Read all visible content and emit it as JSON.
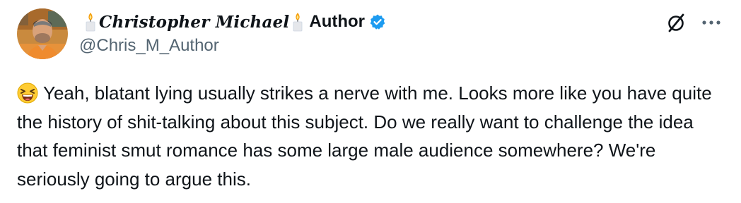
{
  "author": {
    "display_name": "Christopher Michael",
    "name_suffix": "Author",
    "handle": "@Chris_M_Author",
    "verified": true,
    "verified_color": "#1d9bf0"
  },
  "actions": {
    "grok_icon": "slashed-circle-icon",
    "more_icon": "ellipsis-icon"
  },
  "tweet": {
    "emoji": "laughing-face-icon",
    "text": "Yeah, blatant lying usually strikes a nerve with me.  Looks more like you have quite the history of shit-talking about this subject.  Do we really want to challenge the idea that feminist smut romance has some large male audience somewhere?  We're seriously going to argue this."
  }
}
